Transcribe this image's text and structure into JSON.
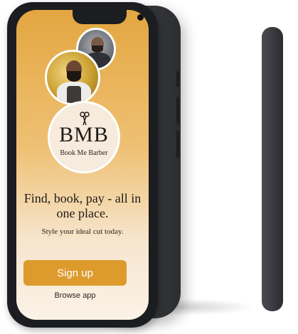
{
  "app": {
    "logo_mark": "BMB",
    "logo_name": "Book Me Barber"
  },
  "hero": {
    "headline": "Find, book, pay - all in one place.",
    "tagline": "Style your ideal cut today."
  },
  "actions": {
    "signup_label": "Sign up",
    "browse_label": "Browse app"
  },
  "icons": {
    "logo_icon": "scissors-icon"
  },
  "colors": {
    "accent": "#dd9b2e",
    "gradient_top": "#e3a640",
    "gradient_bottom": "#fbf2e6",
    "text_dark": "#1f1a16"
  }
}
